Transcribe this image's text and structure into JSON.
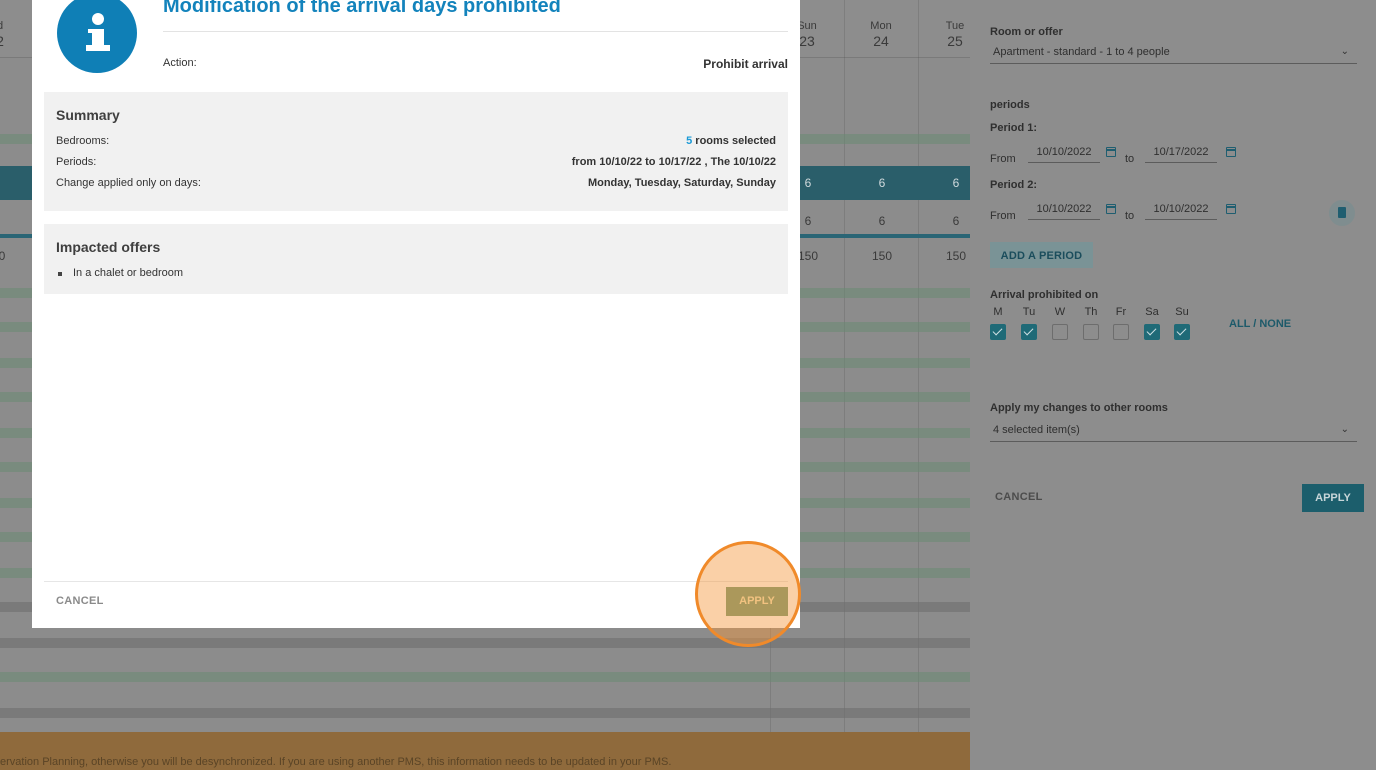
{
  "calendar": {
    "days": [
      {
        "name": "d",
        "date": "2"
      },
      {
        "name": "Sun",
        "date": "23"
      },
      {
        "name": "Mon",
        "date": "24"
      },
      {
        "name": "Tue",
        "date": "25"
      }
    ],
    "band_values": [
      "6",
      "6",
      "6"
    ],
    "row_values": [
      "6",
      "6",
      "6"
    ],
    "price_values": [
      "0",
      "150",
      "150",
      "150"
    ],
    "footer_text": "ervation Planning, otherwise you will be desynchronized. If you are using another PMS, this information needs to be updated in your PMS."
  },
  "modal": {
    "title": "Modification of the arrival days prohibited",
    "action_label": "Action:",
    "action_value": "Prohibit arrival",
    "summary": {
      "title": "Summary",
      "rows": [
        {
          "label": "Bedrooms:",
          "count": "5",
          "value": " rooms selected"
        },
        {
          "label": "Periods:",
          "value": "from 10/10/22 to 10/17/22 , The 10/10/22"
        },
        {
          "label": "Change applied only on days:",
          "value": "Monday, Tuesday, Saturday, Sunday"
        }
      ]
    },
    "impacted": {
      "title": "Impacted offers",
      "items": [
        "In a chalet or bedroom"
      ]
    },
    "cancel_label": "CANCEL",
    "apply_label": "APPLY"
  },
  "side_panel": {
    "room_label": "Room or offer",
    "room_value": "Apartment - standard - 1 to 4 people",
    "periods_label": "periods",
    "periods": [
      {
        "label": "Period 1:",
        "from_label": "From",
        "from": "10/10/2022",
        "to_label": "to",
        "to": "10/17/2022"
      },
      {
        "label": "Period 2:",
        "from_label": "From",
        "from": "10/10/2022",
        "to_label": "to",
        "to": "10/10/2022"
      }
    ],
    "add_period_label": "ADD A PERIOD",
    "arrival_label": "Arrival prohibited on",
    "days": [
      {
        "label": "M",
        "checked": true
      },
      {
        "label": "Tu",
        "checked": true
      },
      {
        "label": "W",
        "checked": false
      },
      {
        "label": "Th",
        "checked": false
      },
      {
        "label": "Fr",
        "checked": false
      },
      {
        "label": "Sa",
        "checked": true
      },
      {
        "label": "Su",
        "checked": true
      }
    ],
    "all_none_label": "ALL / NONE",
    "apply_other_label": "Apply my changes to other rooms",
    "apply_other_value": "4 selected item(s)",
    "cancel_label": "CANCEL",
    "apply_label": "APPLY"
  }
}
